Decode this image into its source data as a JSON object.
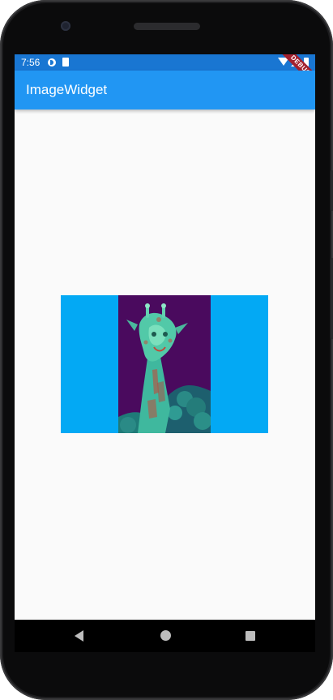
{
  "status_bar": {
    "time": "7:56",
    "icons": [
      "data-saver-icon",
      "sd-card-icon",
      "wifi-icon",
      "signal-icon",
      "battery-icon"
    ],
    "debug_banner": "DEBUG",
    "color": "#1976d2"
  },
  "app_bar": {
    "title": "ImageWidget",
    "color": "#2196f3"
  },
  "content": {
    "background": "#fafafa",
    "image_container_color": "#03a9f4",
    "image_icon": "giraffe-image"
  },
  "nav_bar": {
    "icons": [
      "back-icon",
      "home-icon",
      "recent-apps-icon"
    ]
  }
}
